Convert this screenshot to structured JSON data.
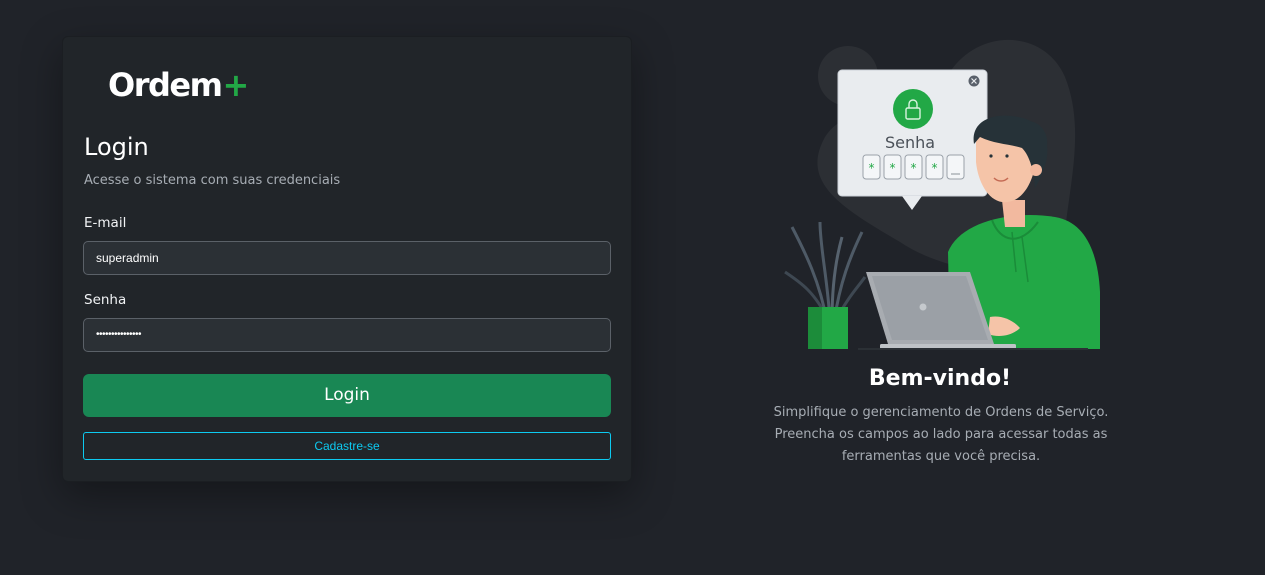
{
  "brand": {
    "name": "Ordem",
    "symbol": "+",
    "accent": "#22a846"
  },
  "login": {
    "title": "Login",
    "subtitle": "Acesse o sistema com suas credenciais",
    "email_label": "E-mail",
    "email_value": "superadmin",
    "password_label": "Senha",
    "password_value": "•••••••••••••••",
    "submit_label": "Login",
    "register_label": "Cadastre-se"
  },
  "illustration": {
    "popup_title": "Senha",
    "icons": [
      "lock-icon",
      "close-icon"
    ]
  },
  "welcome": {
    "title": "Bem-vindo!",
    "line1": "Simplifique o gerenciamento de Ordens de Serviço.",
    "line2": "Preencha os campos ao lado para acessar todas as",
    "line3": "ferramentas que você precisa."
  },
  "colors": {
    "background": "#202329",
    "card": "#212529",
    "primary_button": "#198754",
    "outline_button": "#0dcaf0"
  }
}
